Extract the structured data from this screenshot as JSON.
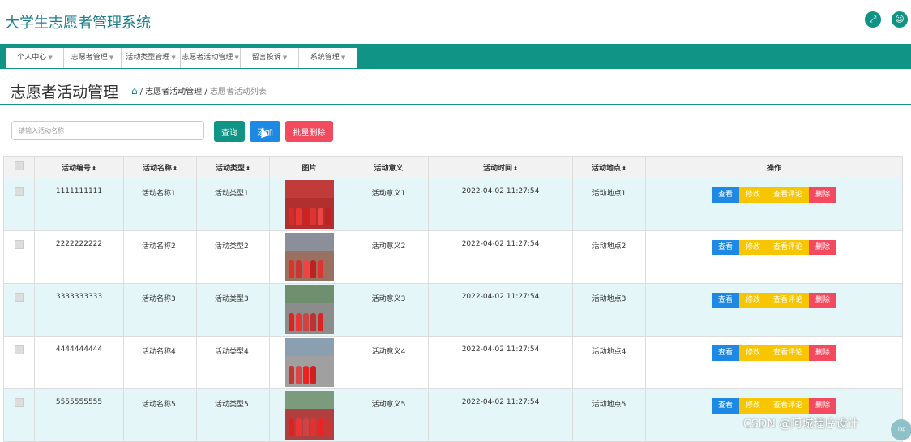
{
  "header": {
    "title": "大学生志愿者管理系统",
    "icons": [
      "fullscreen-icon",
      "user-icon"
    ]
  },
  "nav": [
    "个人中心",
    "志愿者管理",
    "活动类型管理",
    "志愿者活动管理",
    "留言投诉",
    "系统管理"
  ],
  "page": {
    "title": "志愿者活动管理",
    "breadcrumb": {
      "parent": "志愿者活动管理",
      "separator": "/",
      "current": "志愿者活动列表"
    }
  },
  "toolbar": {
    "search_placeholder": "请输入活动名称",
    "query_label": "查询",
    "add_label": "添加",
    "batch_delete_label": "批量删除"
  },
  "colors": {
    "primary": "#0f9485",
    "view": "#1e88e5",
    "edit": "#f7c600",
    "delete": "#f44a5f",
    "row_alt": "#e4f6f7"
  },
  "table": {
    "headers": [
      "",
      "活动编号",
      "活动名称",
      "活动类型",
      "图片",
      "活动意义",
      "活动时间",
      "活动地点",
      "操作"
    ],
    "sortable": [
      false,
      true,
      true,
      true,
      false,
      false,
      true,
      true,
      false
    ],
    "row_actions": [
      "查看",
      "修改",
      "查看评论",
      "删除"
    ],
    "rows": [
      {
        "id": "1111111111",
        "name": "活动名称1",
        "type": "活动类型1",
        "meaning": "活动意义1",
        "time": "2022-04-02 11:27:54",
        "place": "活动地点1"
      },
      {
        "id": "2222222222",
        "name": "活动名称2",
        "type": "活动类型2",
        "meaning": "活动意义2",
        "time": "2022-04-02 11:27:54",
        "place": "活动地点2"
      },
      {
        "id": "3333333333",
        "name": "活动名称3",
        "type": "活动类型3",
        "meaning": "活动意义3",
        "time": "2022-04-02 11:27:54",
        "place": "活动地点3"
      },
      {
        "id": "4444444444",
        "name": "活动名称4",
        "type": "活动类型4",
        "meaning": "活动意义4",
        "time": "2022-04-02 11:27:54",
        "place": "活动地点4"
      },
      {
        "id": "5555555555",
        "name": "活动名称5",
        "type": "活动类型5",
        "meaning": "活动意义5",
        "time": "2022-04-02 11:27:54",
        "place": "活动地点5"
      }
    ]
  },
  "overlay": {
    "watermark": "CSDN @阿城程序设计",
    "top_label": "Top"
  }
}
